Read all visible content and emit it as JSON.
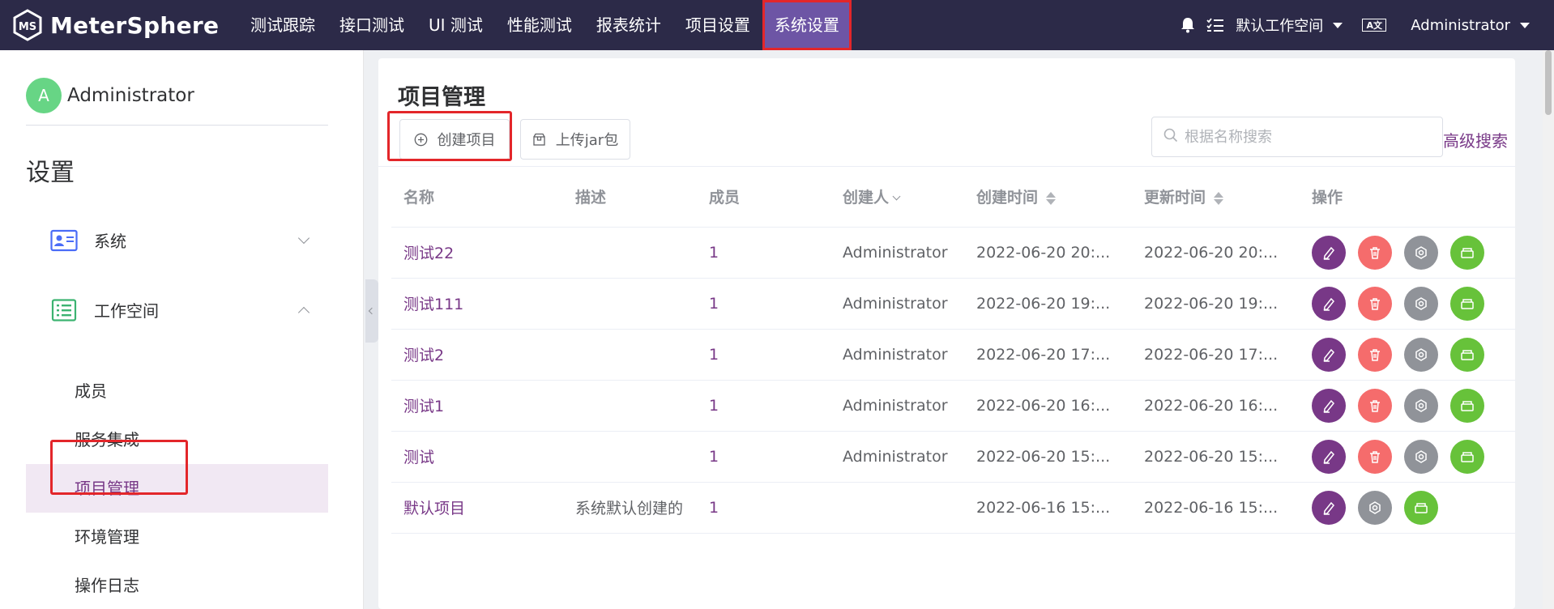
{
  "app": {
    "name": "MeterSphere"
  },
  "topnav": {
    "menu": [
      {
        "label": "测试跟踪"
      },
      {
        "label": "接口测试"
      },
      {
        "label": "UI 测试"
      },
      {
        "label": "性能测试"
      },
      {
        "label": "报表统计"
      },
      {
        "label": "项目设置"
      },
      {
        "label": "系统设置",
        "active": true
      }
    ],
    "workspace": "默认工作空间",
    "lang_badge": "A文",
    "user": "Administrator"
  },
  "sidebar": {
    "avatar_letter": "A",
    "user_name": "Administrator",
    "title": "设置",
    "groups": [
      {
        "label": "系统",
        "icon": "id-card-icon",
        "expanded": false
      },
      {
        "label": "工作空间",
        "icon": "list-icon",
        "expanded": true
      }
    ],
    "items": [
      {
        "label": "成员"
      },
      {
        "label": "服务集成"
      },
      {
        "label": "项目管理",
        "active": true
      },
      {
        "label": "环境管理"
      },
      {
        "label": "操作日志"
      }
    ]
  },
  "main": {
    "title": "项目管理",
    "create_label": "创建项目",
    "upload_label": "上传jar包",
    "search_placeholder": "根据名称搜索",
    "advanced_search": "高级搜索",
    "columns": [
      "名称",
      "描述",
      "成员",
      "创建人",
      "创建时间",
      "更新时间",
      "操作"
    ],
    "rows": [
      {
        "name": "测试22",
        "desc": "",
        "members": "1",
        "creator": "Administrator",
        "created": "2022-06-20 20:...",
        "updated": "2022-06-20 20:...",
        "deletable": true
      },
      {
        "name": "测试111",
        "desc": "",
        "members": "1",
        "creator": "Administrator",
        "created": "2022-06-20 19:...",
        "updated": "2022-06-20 19:...",
        "deletable": true
      },
      {
        "name": "测试2",
        "desc": "",
        "members": "1",
        "creator": "Administrator",
        "created": "2022-06-20 17:...",
        "updated": "2022-06-20 17:...",
        "deletable": true
      },
      {
        "name": "测试1",
        "desc": "",
        "members": "1",
        "creator": "Administrator",
        "created": "2022-06-20 16:...",
        "updated": "2022-06-20 16:...",
        "deletable": true
      },
      {
        "name": "测试",
        "desc": "",
        "members": "1",
        "creator": "Administrator",
        "created": "2022-06-20 15:...",
        "updated": "2022-06-20 15:...",
        "deletable": true
      },
      {
        "name": "默认项目",
        "desc": "系统默认创建的",
        "members": "1",
        "creator": "",
        "created": "2022-06-16 15:...",
        "updated": "2022-06-16 15:...",
        "deletable": false
      }
    ]
  },
  "colors": {
    "nav_bg": "#2c2a48",
    "accent": "#783887",
    "active_menu": "#6d55a5",
    "highlight": "#e3262a",
    "delete": "#f56c6c",
    "config": "#909399",
    "environment": "#67c23a"
  }
}
